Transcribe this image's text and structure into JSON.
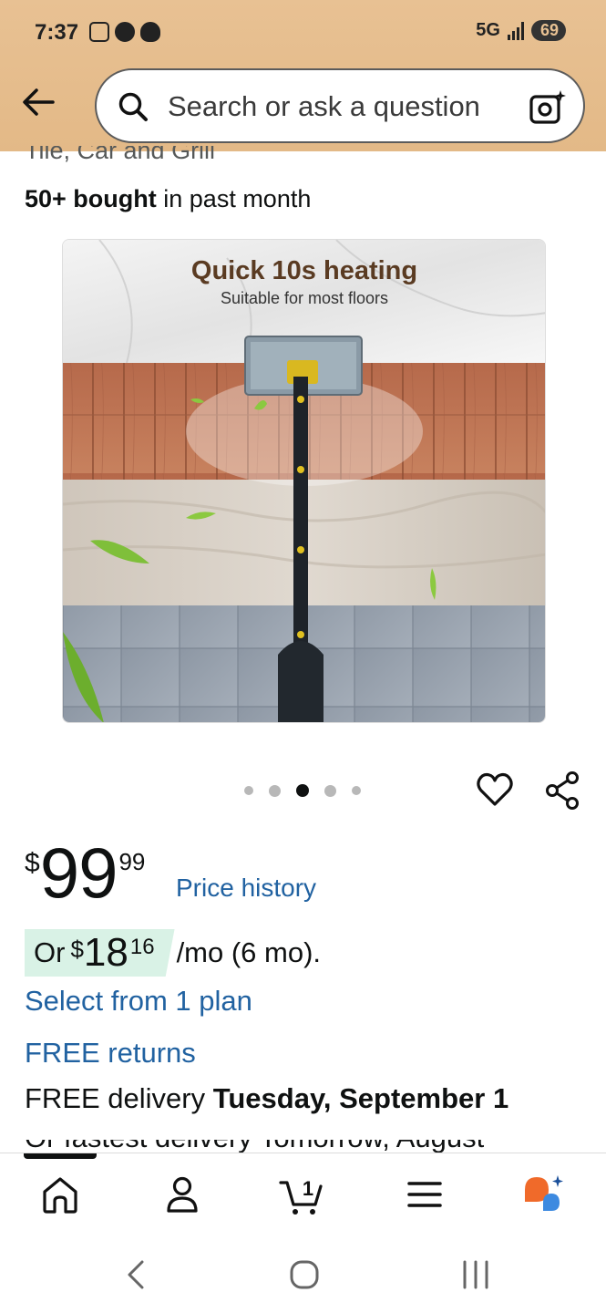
{
  "status_bar": {
    "time": "7:37",
    "network": "5G",
    "battery": "69"
  },
  "header": {
    "search_placeholder": "Search or ask a question"
  },
  "product": {
    "title_clipped": "Tile, Car and Grill",
    "bought_count": "50+ bought",
    "bought_suffix": " in past month",
    "image": {
      "headline": "Quick 10s heating",
      "subline": "Suitable for most floors"
    },
    "carousel": {
      "count": 5,
      "active_index": 2
    }
  },
  "pricing": {
    "currency": "$",
    "whole": "99",
    "fraction": "99",
    "price_history_link": "Price history",
    "monthly_prefix": "Or",
    "monthly_currency": "$",
    "monthly_whole": "18",
    "monthly_fraction": "16",
    "monthly_suffix": "/mo (6 mo).",
    "select_plan_link": "Select from 1 plan"
  },
  "shipping": {
    "free_returns_link": "FREE returns",
    "delivery_prefix": "FREE delivery ",
    "delivery_date": "Tuesday, September 1",
    "next_line_clipped": "Or fastest delivery Tomorrow, August"
  },
  "bottom_nav": {
    "items": [
      "home",
      "account",
      "cart",
      "menu",
      "rufus"
    ],
    "cart_count": "1",
    "active": "home"
  },
  "colors": {
    "header_bg": "#e3b987",
    "link": "#2162a1",
    "installment_bg": "#d9f2e6",
    "rufus_orange": "#f06a2a",
    "rufus_blue": "#3d8ae0"
  }
}
